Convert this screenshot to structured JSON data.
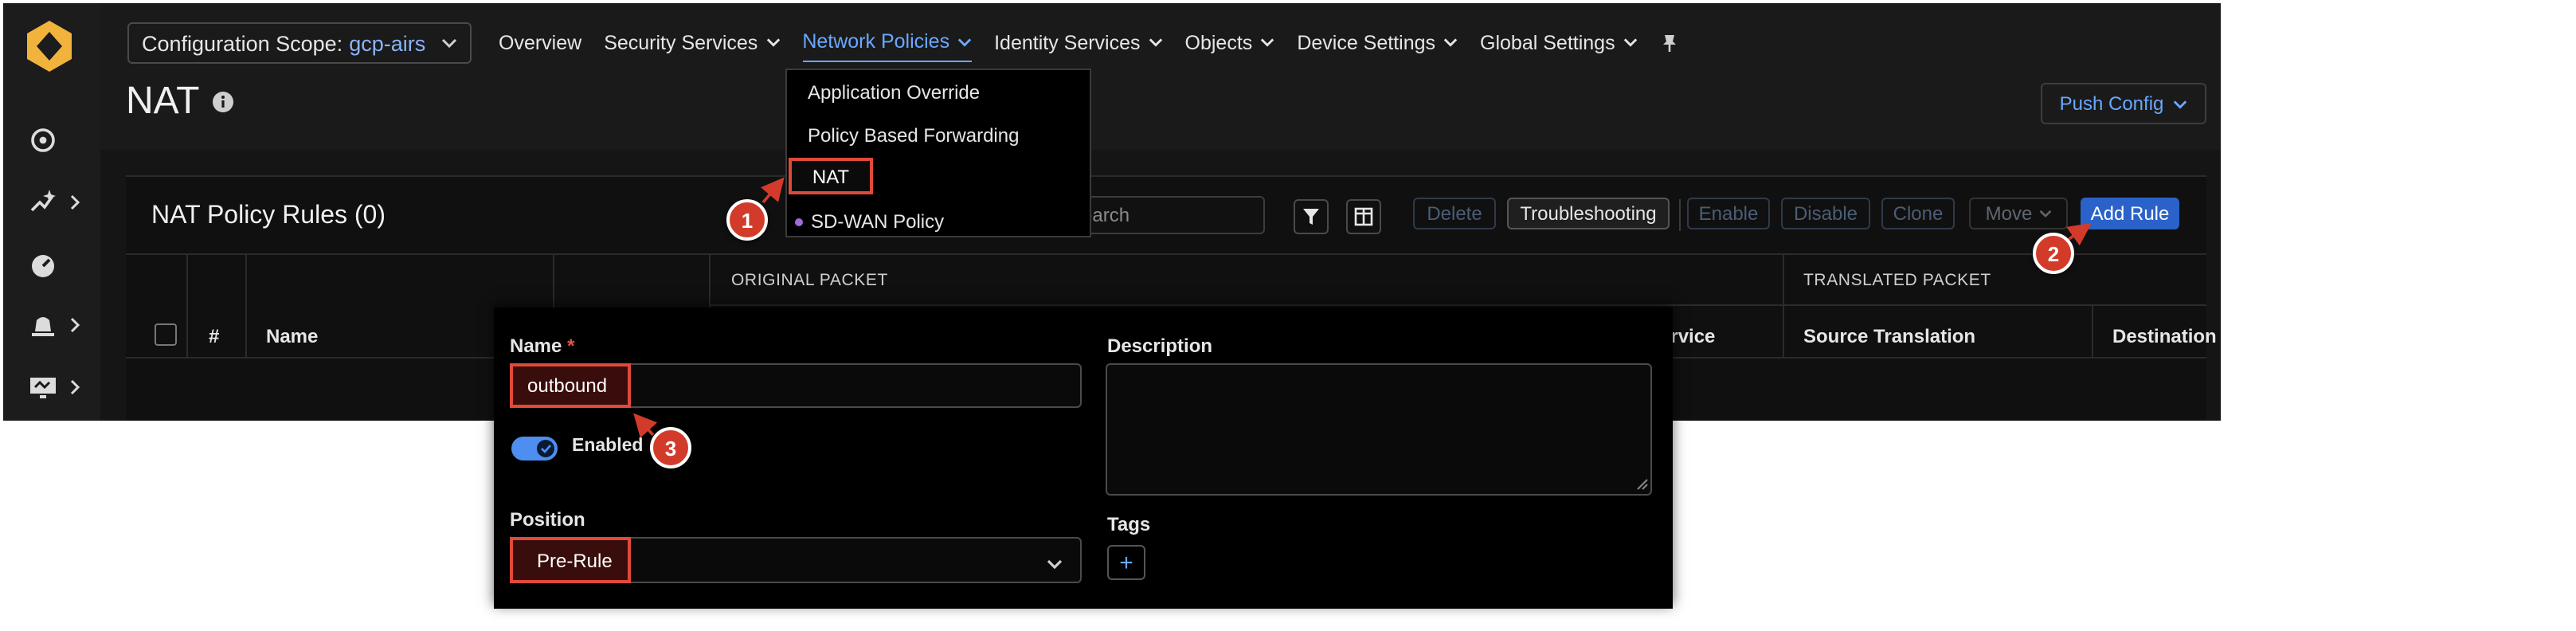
{
  "nav": {
    "scope_label": "Configuration Scope:",
    "scope_value": "gcp-airs",
    "items": [
      "Overview",
      "Security Services",
      "Network Policies",
      "Identity Services",
      "Objects",
      "Device Settings",
      "Global Settings"
    ],
    "active_index": 2
  },
  "page": {
    "title": "NAT",
    "push_config": "Push Config"
  },
  "network_policies_menu": {
    "items": [
      "Application Override",
      "Policy Based Forwarding",
      "NAT",
      "SD-WAN Policy"
    ],
    "selected": "NAT"
  },
  "table": {
    "title": "NAT Policy Rules (0)",
    "search_placeholder": "earch",
    "toolbar": {
      "delete": "Delete",
      "troubleshooting": "Troubleshooting",
      "enable": "Enable",
      "disable": "Disable",
      "clone": "Clone",
      "move": "Move",
      "add_rule": "Add Rule"
    },
    "group_headers": {
      "original": "ORIGINAL PACKET",
      "translated": "TRANSLATED PACKET"
    },
    "columns": {
      "number": "#",
      "name": "Name",
      "service": "ervice",
      "source_translation": "Source Translation",
      "destination": "Destination"
    }
  },
  "form": {
    "name_label": "Name",
    "name_value": "outbound",
    "description_label": "Description",
    "enabled_label": "Enabled",
    "position_label": "Position",
    "position_value": "Pre-Rule",
    "tags_label": "Tags",
    "tags_add": "+"
  },
  "callouts": [
    "1",
    "2",
    "3"
  ],
  "colors": {
    "accent": "#6aa8ff",
    "primary_button": "#2a62c9",
    "highlight": "#e04a3a",
    "callout": "#d23b2a"
  }
}
